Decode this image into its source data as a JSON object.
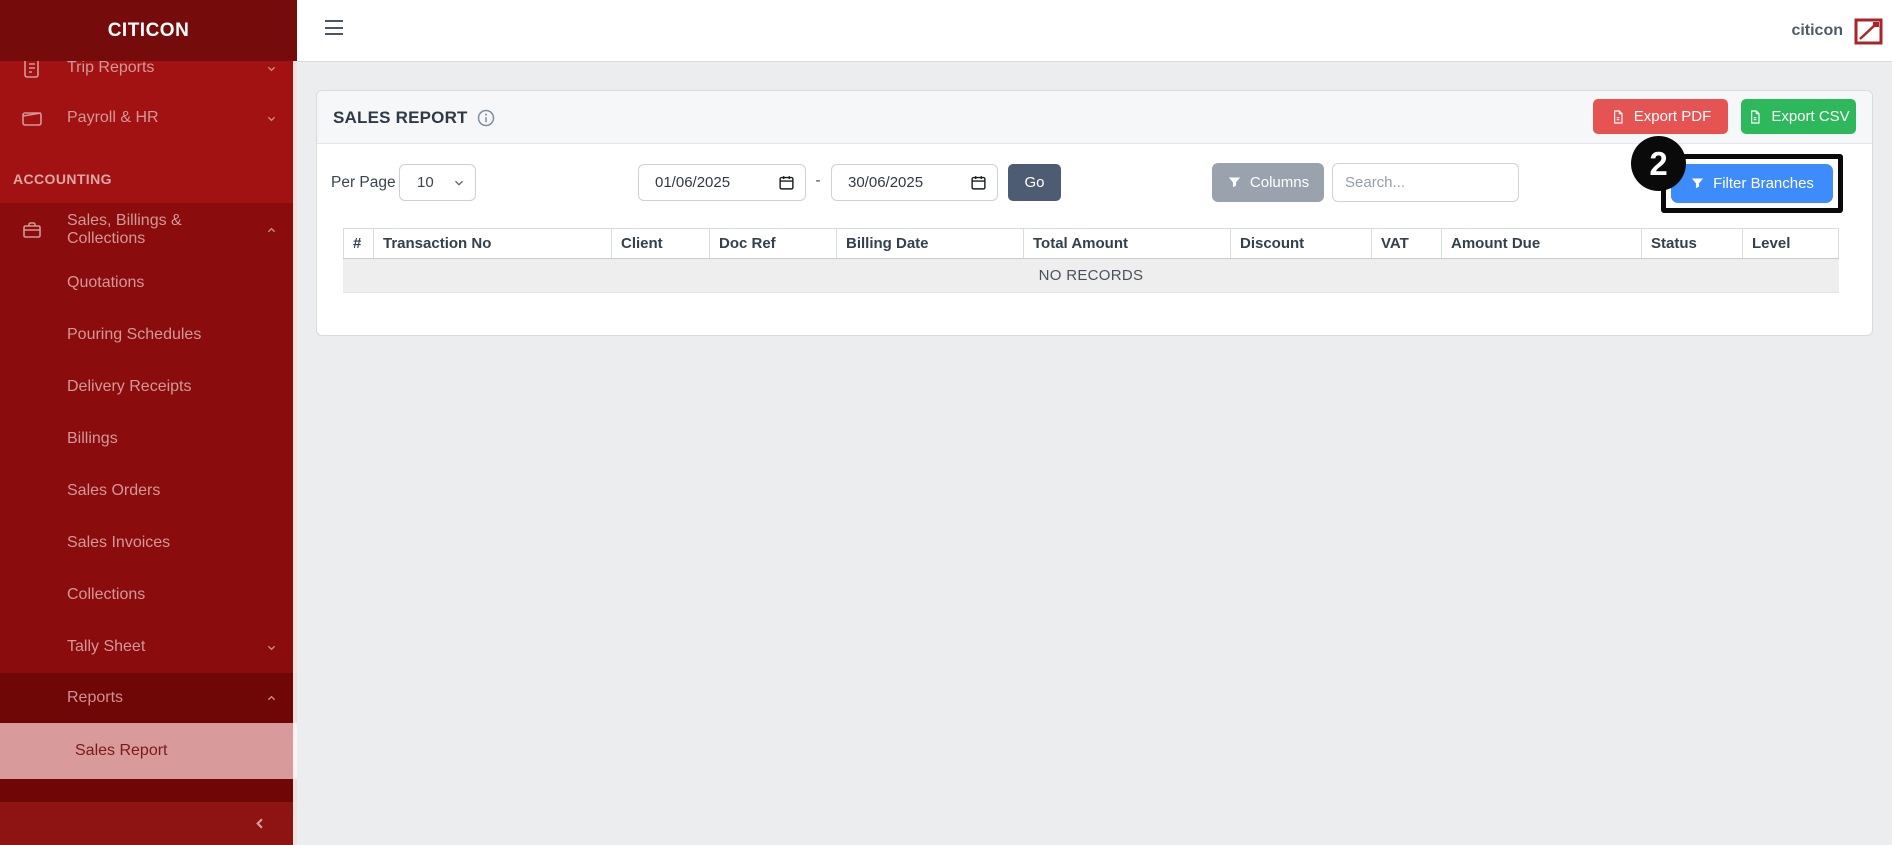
{
  "topbar": {
    "username": "citicon"
  },
  "sidebar": {
    "brand": "CITICON",
    "section_label": "ACCOUNTING",
    "items": {
      "trip_reports": "Trip Reports",
      "payroll_hr": "Payroll & HR",
      "sales_billings_collections": "Sales, Billings & Collections",
      "quotations": "Quotations",
      "pouring_schedules": "Pouring Schedules",
      "delivery_receipts": "Delivery Receipts",
      "billings": "Billings",
      "sales_orders": "Sales Orders",
      "sales_invoices": "Sales Invoices",
      "collections": "Collections",
      "tally_sheet": "Tally Sheet",
      "reports": "Reports",
      "sales_report": "Sales Report"
    }
  },
  "report": {
    "title": "SALES REPORT",
    "export_pdf_label": "Export PDF",
    "export_csv_label": "Export CSV",
    "per_page_label": "Per Page",
    "per_page_value": "10",
    "date_from": "01/06/2025",
    "date_range_separator": "-",
    "date_to": "30/06/2025",
    "go_label": "Go",
    "columns_label": "Columns",
    "search_placeholder": "Search...",
    "filter_branches_label": "Filter Branches",
    "table": {
      "headers": [
        "#",
        "Transaction No",
        "Client",
        "Doc Ref",
        "Billing Date",
        "Total Amount",
        "Discount",
        "VAT",
        "Amount Due",
        "Status",
        "Level"
      ],
      "empty_text": "NO RECORDS"
    }
  },
  "annotation": {
    "badge_number": "2"
  },
  "colors": {
    "sidebar_header": "#750b0b",
    "sidebar_base": "#a21212",
    "sidebar_group": "#8b0c0c",
    "sidebar_dark_row": "#700707",
    "sidebar_active_bg": "#d89a9a",
    "sidebar_footer": "#8e1414",
    "export_pdf": "#e55353",
    "export_csv": "#2eb85c",
    "filter_branches": "#3e8bfb",
    "go_button": "#4d5c72",
    "columns_button": "#9aa3ad",
    "annotation": "#0a0a0a"
  }
}
